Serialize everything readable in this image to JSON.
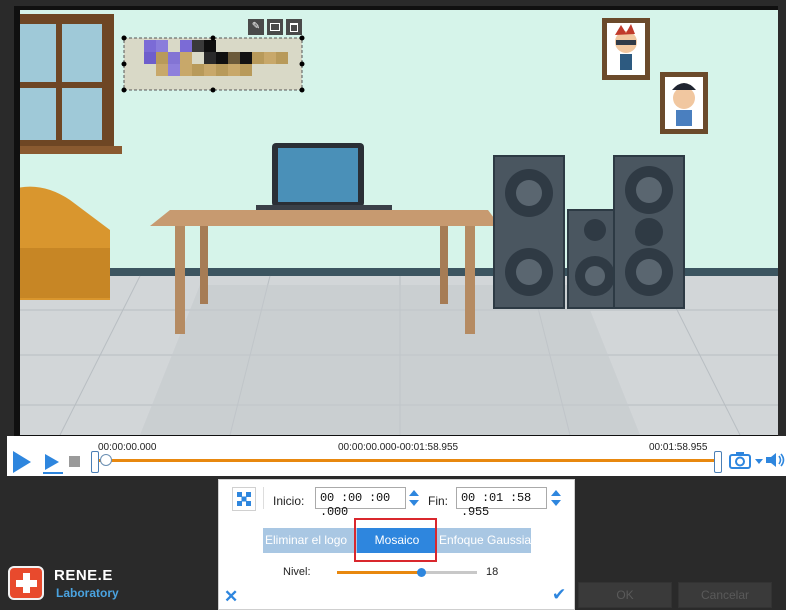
{
  "timeline": {
    "start_time": "00:00:00.000",
    "range": "00:00:00.000-00:01:58.955",
    "end_time": "00:01:58.955"
  },
  "panel": {
    "start_label": "Inicio:",
    "start_value": "00 :00 :00 .000",
    "end_label": "Fin:",
    "end_value": "00 :01 :58 .955",
    "tabs": [
      "Eliminar el logo",
      "Mosaico",
      "Enfoque Gaussiano"
    ],
    "active_tab": "Mosaico",
    "level_label": "Nivel:",
    "level_value": "18",
    "level_fraction": 0.6
  },
  "buttons": {
    "ok": "OK",
    "cancel": "Cancelar"
  },
  "logo": {
    "name": "RENE.E",
    "sub": "Laboratory"
  },
  "colors": {
    "accent": "#2e86de",
    "progress": "#e8880f",
    "highlight": "#d9272d"
  },
  "icons": [
    "play-icon",
    "play-next-icon",
    "stop-icon",
    "camera-icon",
    "volume-icon",
    "mosaic-icon",
    "close-icon",
    "check-icon",
    "edit-icon",
    "image-icon",
    "trash-icon"
  ]
}
